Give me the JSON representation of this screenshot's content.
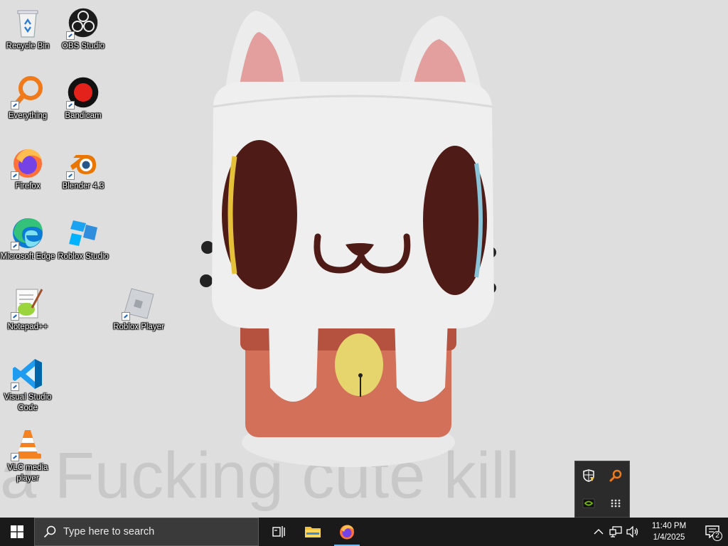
{
  "wallpaper": {
    "caption": "a Fucking cute kill",
    "background_color": "#dedede"
  },
  "desktop_icons": [
    {
      "label": "Recycle Bin",
      "icon": "recycle-bin-icon",
      "shortcut": false
    },
    {
      "label": "OBS Studio",
      "icon": "obs-studio-icon",
      "shortcut": true
    },
    {
      "label": "Everything",
      "icon": "everything-search-icon",
      "shortcut": true
    },
    {
      "label": "Bandicam",
      "icon": "bandicam-icon",
      "shortcut": true
    },
    {
      "label": "Firefox",
      "icon": "firefox-icon",
      "shortcut": true
    },
    {
      "label": "Blender 4.3",
      "icon": "blender-icon",
      "shortcut": true
    },
    {
      "label": "Microsoft Edge",
      "icon": "edge-icon",
      "shortcut": true
    },
    {
      "label": "Roblox Studio",
      "icon": "roblox-studio-icon",
      "shortcut": false
    },
    {
      "label": "Notepad++",
      "icon": "notepad-plus-plus-icon",
      "shortcut": true
    },
    {
      "label": "Roblox Player",
      "icon": "roblox-player-icon",
      "shortcut": true
    },
    {
      "label": "Visual Studio Code",
      "icon": "vscode-icon",
      "shortcut": true
    },
    {
      "label": "VLC media player",
      "icon": "vlc-icon",
      "shortcut": true
    }
  ],
  "taskbar": {
    "search_placeholder": "Type here to search",
    "pinned": [
      {
        "name": "task-view",
        "icon": "task-view-icon"
      },
      {
        "name": "file-explorer",
        "icon": "folder-icon"
      },
      {
        "name": "firefox",
        "icon": "firefox-icon",
        "running": true
      }
    ],
    "tray": {
      "overflow_items": [
        "windows-security-warning-icon",
        "everything-search-icon",
        "nvidia-icon",
        "app-grid-icon"
      ],
      "icons": [
        "chevron-up-icon",
        "network-icon",
        "volume-icon"
      ],
      "time": "11:40 PM",
      "date": "1/4/2025",
      "notification_count": "2"
    }
  },
  "colors": {
    "taskbar_bg": "#1a1a1a",
    "search_bg": "#3a3a3a",
    "accent": "#76b9ed"
  }
}
